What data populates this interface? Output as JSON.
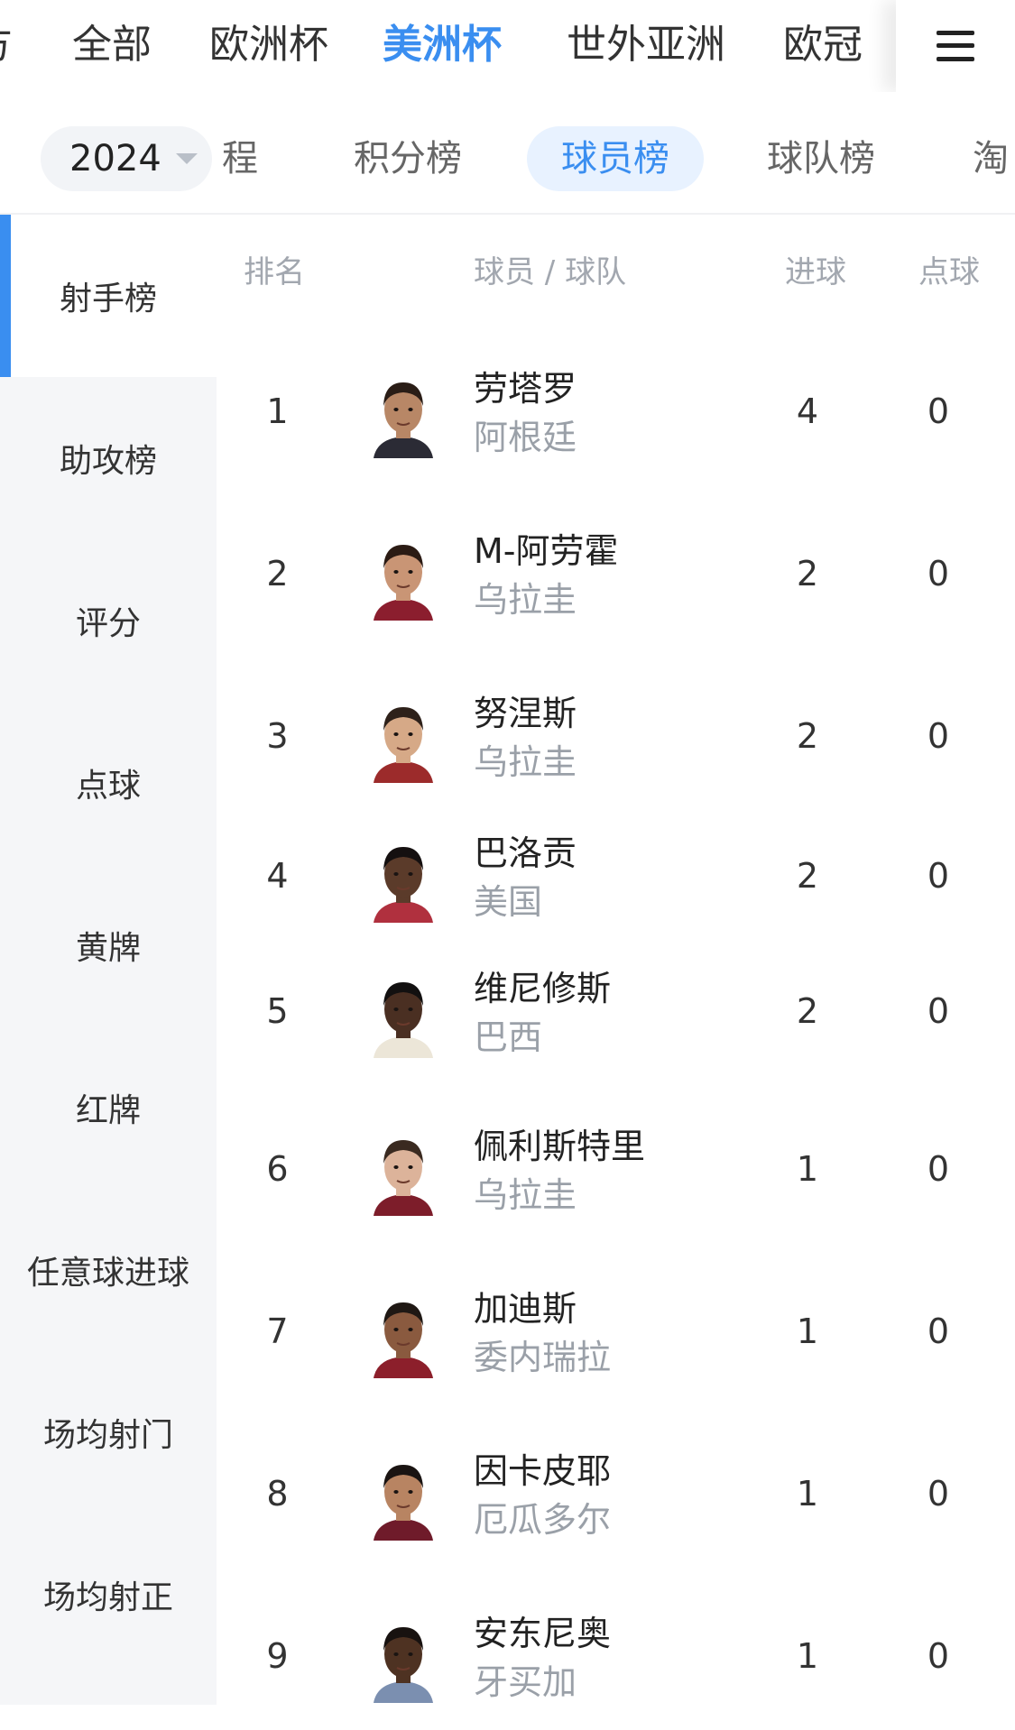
{
  "top_nav": {
    "tabs": [
      {
        "label": "方"
      },
      {
        "label": "全部"
      },
      {
        "label": "欧洲杯"
      },
      {
        "label": "美洲杯"
      },
      {
        "label": "世外亚洲"
      },
      {
        "label": "欧冠"
      }
    ],
    "active_index": 3,
    "menu_icon": "hamburger-menu-icon"
  },
  "sub_nav": {
    "year": "2024",
    "tabs": [
      {
        "label": "程"
      },
      {
        "label": "积分榜"
      },
      {
        "label": "球员榜"
      },
      {
        "label": "球队榜"
      },
      {
        "label": "淘"
      }
    ],
    "active_index": 2
  },
  "sidebar": {
    "items": [
      {
        "label": "射手榜"
      },
      {
        "label": "助攻榜"
      },
      {
        "label": "评分"
      },
      {
        "label": "点球"
      },
      {
        "label": "黄牌"
      },
      {
        "label": "红牌"
      },
      {
        "label": "任意球进球"
      },
      {
        "label": "场均射门"
      },
      {
        "label": "场均射正"
      }
    ],
    "active_index": 0
  },
  "table": {
    "headers": {
      "rank": "排名",
      "player": "球员 / 球队",
      "goals": "进球",
      "penalties": "点球"
    },
    "rows": [
      {
        "rank": "1",
        "name": "劳塔罗",
        "team": "阿根廷",
        "goals": "4",
        "penalties": "0"
      },
      {
        "rank": "2",
        "name": "M-阿劳霍",
        "team": "乌拉圭",
        "goals": "2",
        "penalties": "0"
      },
      {
        "rank": "3",
        "name": "努涅斯",
        "team": "乌拉圭",
        "goals": "2",
        "penalties": "0"
      },
      {
        "rank": "4",
        "name": "巴洛贡",
        "team": "美国",
        "goals": "2",
        "penalties": "0"
      },
      {
        "rank": "5",
        "name": "维尼修斯",
        "team": "巴西",
        "goals": "2",
        "penalties": "0"
      },
      {
        "rank": "6",
        "name": "佩利斯特里",
        "team": "乌拉圭",
        "goals": "1",
        "penalties": "0"
      },
      {
        "rank": "7",
        "name": "加迪斯",
        "team": "委内瑞拉",
        "goals": "1",
        "penalties": "0"
      },
      {
        "rank": "8",
        "name": "因卡皮耶",
        "team": "厄瓜多尔",
        "goals": "1",
        "penalties": "0"
      },
      {
        "rank": "9",
        "name": "安东尼奥",
        "team": "牙买加",
        "goals": "1",
        "penalties": "0"
      }
    ]
  },
  "colors": {
    "accent": "#3a8ef0",
    "active_pill_bg": "#e8f2ff",
    "sidebar_bg": "#f5f6f8",
    "muted_text": "#9aa0a8"
  }
}
